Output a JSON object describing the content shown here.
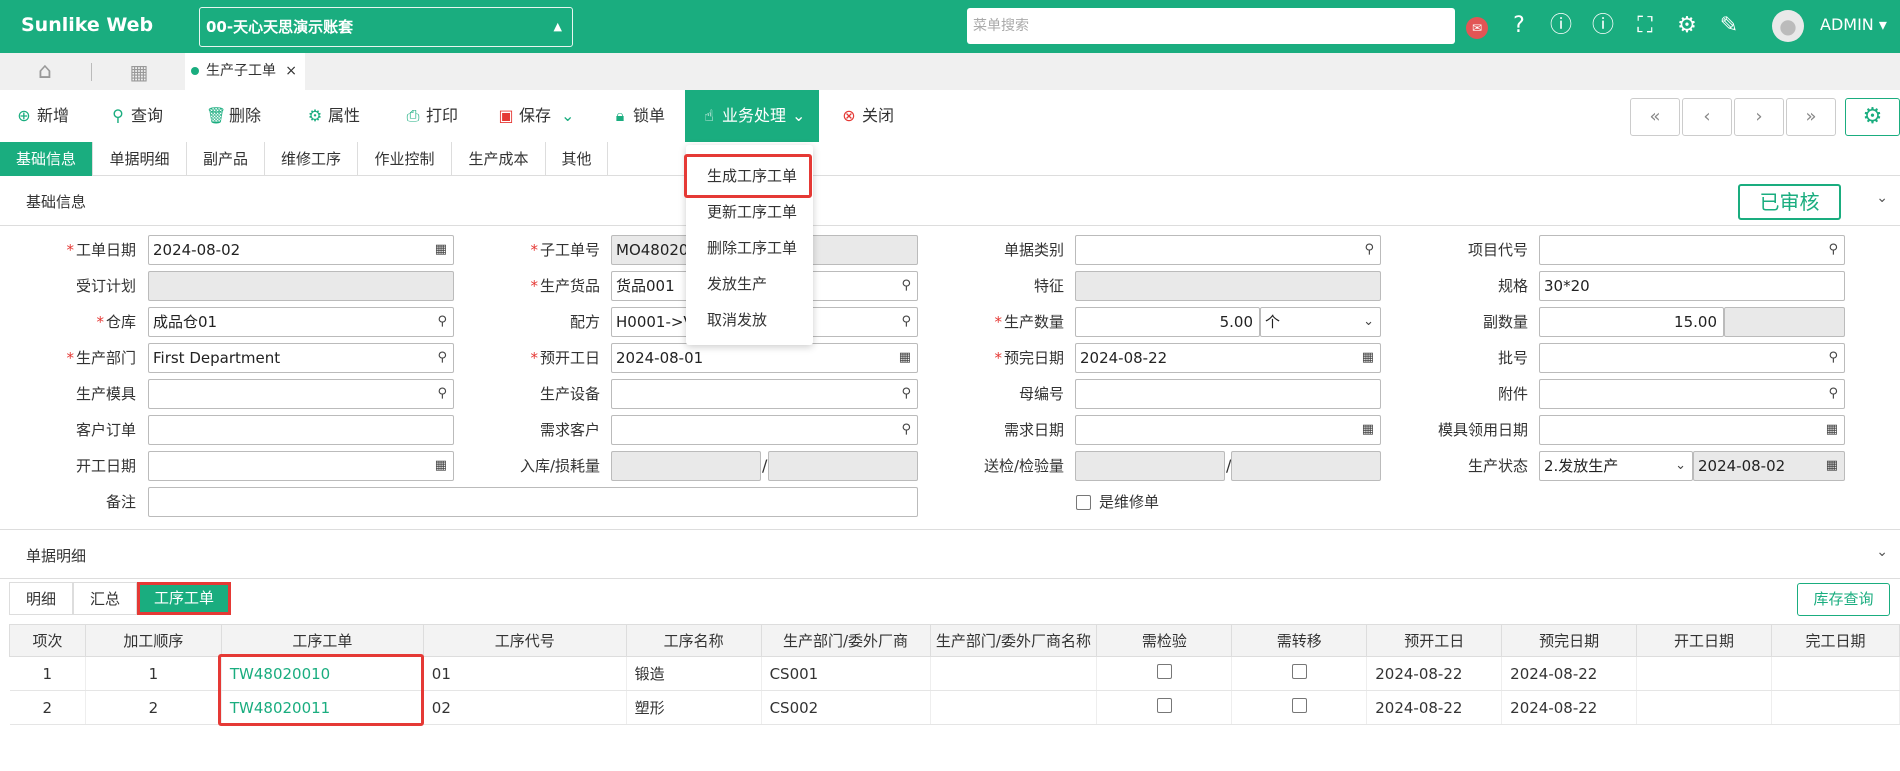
{
  "topbar": {
    "brand": "Sunlike Web",
    "account": "00-天心天思演示账套",
    "search_placeholder": "菜单搜索",
    "user": "ADMIN"
  },
  "tabs": {
    "active": "生产子工单",
    "close": "×"
  },
  "toolbar": {
    "add": "新增",
    "query": "查询",
    "delete": "删除",
    "props": "属性",
    "print": "打印",
    "save": "保存",
    "lock": "锁单",
    "biz": "业务处理",
    "close": "关闭"
  },
  "subtabs": [
    "基础信息",
    "单据明细",
    "副产品",
    "维修工序",
    "作业控制",
    "生产成本",
    "其他"
  ],
  "section_basic": "基础信息",
  "status": "已审核",
  "menu": [
    "生成工序工单",
    "更新工序工单",
    "删除工序工单",
    "发放生产",
    "取消发放"
  ],
  "form": {
    "l_date": "工单日期",
    "v_date": "2024-08-02",
    "l_sub": "子工单号",
    "v_sub": "MO480200",
    "l_doctype": "单据类别",
    "l_proj": "项目代号",
    "l_plan": "受订计划",
    "l_goods": "生产货品",
    "v_goods": "货品001",
    "l_feature": "特征",
    "l_spec": "规格",
    "v_spec": "30*20",
    "l_wh": "仓库",
    "v_wh": "成品仓01",
    "l_formula": "配方",
    "v_formula": "H0001->V",
    "l_qty": "生产数量",
    "v_qty": "5.00",
    "v_unit": "个",
    "l_subqty": "副数量",
    "v_subqty": "15.00",
    "l_dept": "生产部门",
    "v_dept": "First Department",
    "l_pstart": "预开工日",
    "v_pstart": "2024-08-01",
    "l_pend": "预完日期",
    "v_pend": "2024-08-22",
    "l_batch": "批号",
    "l_mold": "生产模具",
    "l_equip": "生产设备",
    "l_parent": "母编号",
    "l_attach": "附件",
    "l_custord": "客户订单",
    "l_demcust": "需求客户",
    "l_demdate": "需求日期",
    "l_molddate": "模具领用日期",
    "l_opendate": "开工日期",
    "l_inloss": "入库/损耗量",
    "l_inspect": "送检/检验量",
    "l_pstatus": "生产状态",
    "v_pstatus": "2.发放生产",
    "v_pstatusdate": "2024-08-02",
    "l_remark": "备注",
    "l_repair": "是维修单"
  },
  "section_detail": "单据明细",
  "detail_tabs": [
    "明细",
    "汇总",
    "工序工单"
  ],
  "stock_query": "库存查询",
  "table": {
    "headers": [
      "项次",
      "加工顺序",
      "工序工单",
      "工序代号",
      "工序名称",
      "生产部门/委外厂商",
      "生产部门/委外厂商名称",
      "需检验",
      "需转移",
      "预开工日",
      "预完日期",
      "开工日期",
      "完工日期"
    ],
    "rows": [
      [
        "1",
        "1",
        "TW48020010",
        "01",
        "锻造",
        "CS001",
        "",
        "",
        "",
        "2024-08-22",
        "2024-08-22",
        "",
        ""
      ],
      [
        "2",
        "2",
        "TW48020011",
        "02",
        "塑形",
        "CS002",
        "",
        "",
        "",
        "2024-08-22",
        "2024-08-22",
        "",
        ""
      ]
    ]
  }
}
